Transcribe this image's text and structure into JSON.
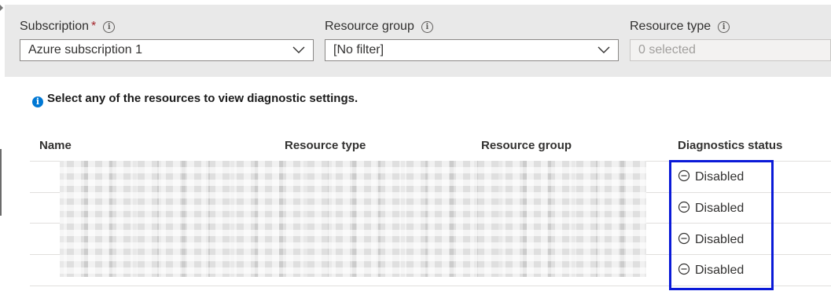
{
  "filters": {
    "subscription": {
      "label": "Subscription",
      "required_mark": "*",
      "info": "i",
      "value": "Azure subscription 1"
    },
    "resource_group": {
      "label": "Resource group",
      "info": "i",
      "value": "[No filter]"
    },
    "resource_type": {
      "label": "Resource type",
      "info": "i",
      "placeholder": "0 selected"
    }
  },
  "notice": {
    "icon": "i",
    "text": "Select any of the resources to view diagnostic settings."
  },
  "table": {
    "columns": [
      "Name",
      "Resource type",
      "Resource group",
      "Diagnostics status"
    ],
    "rows": [
      {
        "status": "Disabled"
      },
      {
        "status": "Disabled"
      },
      {
        "status": "Disabled"
      },
      {
        "status": "Disabled"
      }
    ]
  },
  "colors": {
    "accent_highlight": "#0a1ad8",
    "info_blue": "#0078d4",
    "required_red": "#a4262c",
    "filter_bg": "#e9e9e9"
  },
  "icons": {
    "status": "circle-minus-icon",
    "dropdown": "chevron-down-icon",
    "info": "info-icon"
  }
}
